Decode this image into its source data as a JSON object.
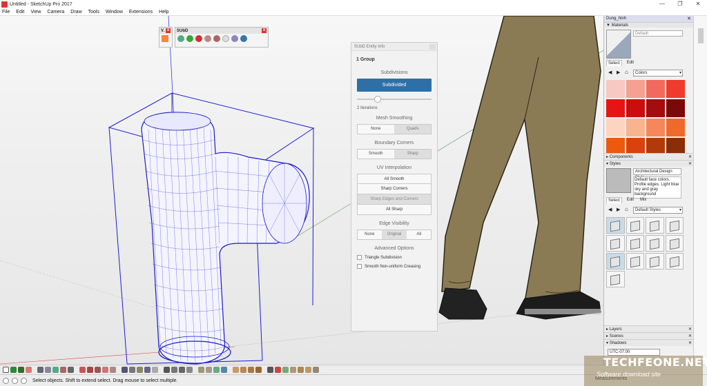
{
  "window": {
    "title": "Untitled - SketchUp Pro 2017",
    "controls": [
      "—",
      "❐",
      "✕"
    ]
  },
  "menu": [
    "File",
    "Edit",
    "View",
    "Camera",
    "Draw",
    "Tools",
    "Window",
    "Extensions",
    "Help"
  ],
  "mini_toolbars": {
    "v_label": "V.",
    "subd_label": "SUbD"
  },
  "subd_panel": {
    "header": "SUbD Entity Info",
    "group_label": "1 Group",
    "subdivisions_title": "Subdivisions",
    "subdivided_button": "Subdivided",
    "iterations_value": 0.25,
    "iterations_text": "2 Iterations",
    "mesh_smoothing_title": "Mesh Smoothing",
    "mesh_smoothing_options": [
      "None",
      "Quads"
    ],
    "boundary_corners_title": "Boundary Corners",
    "boundary_corners_options": [
      "Smooth",
      "Sharp"
    ],
    "uv_title": "UV Interpolation",
    "uv_options": [
      "All Smooth",
      "Sharp Corners",
      "Sharp Edges and Corners",
      "All Sharp"
    ],
    "edge_visibility_title": "Edge Visibility",
    "edge_visibility_options": [
      "None",
      "Original",
      "All"
    ],
    "advanced_title": "Advanced Options",
    "advanced_options": [
      "Triangle Subdivision",
      "Smooth Non-uniform Creasing"
    ]
  },
  "tray": {
    "title": "Dung_hinh",
    "materials_header": "Materials",
    "material_name": "Default",
    "materials_tabs": [
      "Select",
      "Edit"
    ],
    "colors_select": "Colors",
    "swatch_colors": [
      "#f8c9c0",
      "#f5a090",
      "#f26a5c",
      "#ee3b2e",
      "#e61414",
      "#cc0d0d",
      "#a30d0d",
      "#7a0a0a",
      "#fdd4c0",
      "#f9b38f",
      "#f5875a",
      "#ef6a2a",
      "#ec5a10",
      "#d9420e",
      "#b23a0a",
      "#8a2e08"
    ],
    "components_header": "Components",
    "styles_header": "Styles",
    "style_name": "Architectural Design Style",
    "style_desc": "Default face colors. Profile edges. Light blue sky and gray background",
    "styles_tabs": [
      "Select",
      "Edit",
      "Mix"
    ],
    "styles_select": "Default Styles",
    "layers_header": "Layers",
    "scenes_header": "Scenes",
    "shadows_header": "Shadows",
    "utc_value": "UTC-07:00"
  },
  "status": {
    "text": "Select objects. Shift to extend select. Drag mouse to select multiple.",
    "measurements_label": "Measurements"
  },
  "watermark": {
    "title": "TECHFEONE.NET",
    "subtitle": "Software download site"
  }
}
